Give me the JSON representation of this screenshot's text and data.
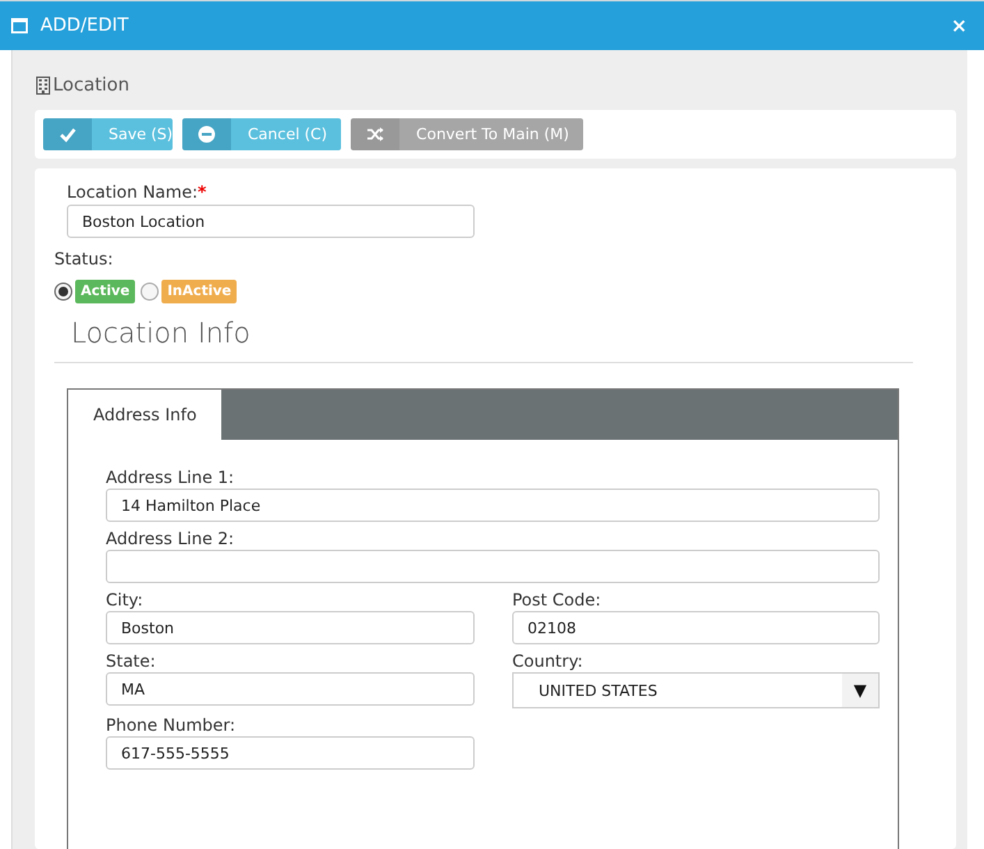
{
  "window": {
    "title": "ADD/EDIT",
    "close": "×"
  },
  "section_title": "Location",
  "buttons": [
    {
      "kind": "save",
      "label": "Save (S)",
      "disabled": false
    },
    {
      "kind": "cancel",
      "label": "Cancel (C)",
      "disabled": false
    },
    {
      "kind": "convert",
      "label": "Convert To Main (M)",
      "disabled": true
    }
  ],
  "location_name": {
    "label": "Location Name:",
    "required_mark": "*",
    "value": "Boston Location"
  },
  "status": {
    "label": "Status:",
    "options": [
      {
        "label": "Active",
        "selected": true,
        "color": "#5cb85c"
      },
      {
        "label": "InActive",
        "selected": false,
        "color": "#f0ad4e"
      }
    ]
  },
  "info_heading": "Location Info",
  "tabs": [
    {
      "label": "Address Info",
      "selected": true
    }
  ],
  "address_lines": [
    {
      "kind": "text",
      "label": "Address Line 1:",
      "value": "14 Hamilton Place"
    },
    {
      "kind": "text",
      "label": "Address Line 2:"
    }
  ],
  "fields": [
    {
      "kind": "text",
      "label": "City:",
      "value": "Boston"
    },
    {
      "kind": "text",
      "label": "Post Code:",
      "value": "02108"
    },
    {
      "kind": "text",
      "label": "State:",
      "value": "MA"
    },
    {
      "kind": "select",
      "label": "Country:",
      "value": "UNITED STATES",
      "arrow": "▼"
    },
    {
      "kind": "text",
      "label": "Phone Number:",
      "value": "617-555-5555"
    }
  ]
}
